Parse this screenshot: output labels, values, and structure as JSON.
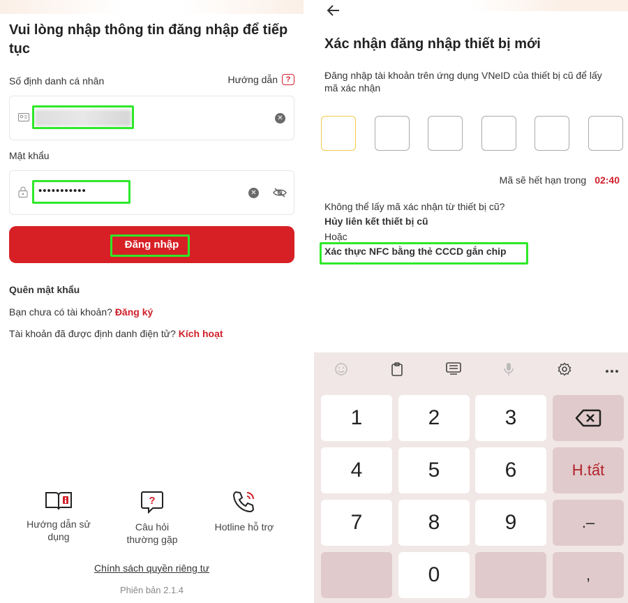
{
  "left": {
    "title": "Vui lòng nhập thông tin đăng nhập để tiếp tục",
    "id_label": "Số định danh cá nhân",
    "guide_label": "Hướng dẫn",
    "password_label": "Mật khẩu",
    "password_value": "•••••••••••",
    "login_button": "Đăng nhập",
    "forgot_password": "Quên mật khẩu",
    "no_account_text": "Bạn chưa có tài khoản?",
    "register_link": "Đăng ký",
    "identified_text": "Tài khoản đã được định danh điện tử?",
    "activate_link": "Kích hoạt",
    "bottom_items": [
      {
        "label": "Hướng dẫn sử dụng",
        "icon": "book-icon"
      },
      {
        "label": "Câu hỏi thường gặp",
        "icon": "faq-icon"
      },
      {
        "label": "Hotline hỗ trợ",
        "icon": "phone-icon"
      }
    ],
    "policy": "Chính sách quyền riêng tư",
    "version": "Phiên bản 2.1.4"
  },
  "right": {
    "title": "Xác nhận đăng nhập thiết bị mới",
    "description": "Đăng nhập tài khoản trên ứng dụng VNeID của thiết bị cũ để lấy mã xác nhận",
    "expire_text": "Mã sẽ hết hạn trong",
    "expire_time": "02:40",
    "cannot_get_text": "Không thể lấy mã xác nhận từ thiết bị cũ?",
    "unlink_link": "Hủy liên kết thiết bị cũ",
    "or_text": "Hoặc",
    "nfc_link": "Xác thực NFC bằng thẻ CCCD gắn chip"
  },
  "keyboard": {
    "toolbar": [
      "emoji-icon",
      "clipboard-icon",
      "keyboard-icon",
      "mic-icon",
      "settings-icon",
      "more-icon"
    ],
    "keys": [
      "1",
      "2",
      "3",
      "4",
      "5",
      "6",
      "7",
      "8",
      "9",
      "0"
    ],
    "backspace": "⌫",
    "done": "H.tất",
    "dot_dash": ".–",
    "comma": ","
  },
  "colors": {
    "brand_red": "#d72025",
    "highlight_green": "#2ee82a",
    "otp_active": "#f1c94b"
  }
}
